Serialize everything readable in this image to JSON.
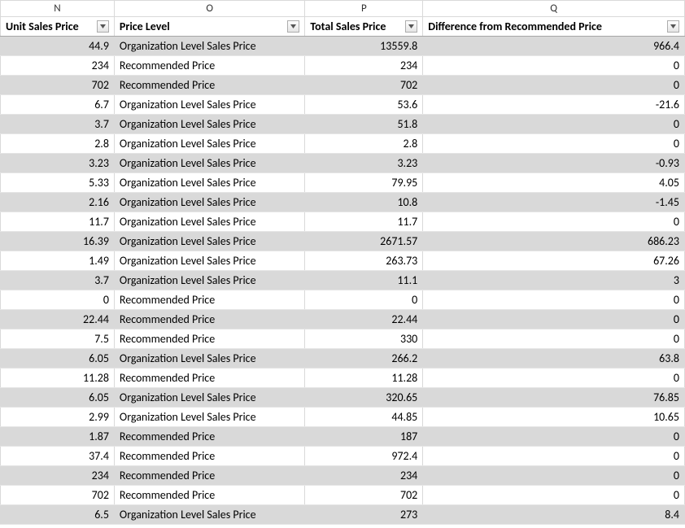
{
  "columns": {
    "letters": [
      "N",
      "O",
      "P",
      "Q"
    ],
    "labels": [
      "Unit Sales Price",
      "Price Level",
      "Total Sales Price",
      "Difference from Recommended Price"
    ]
  },
  "rows": [
    {
      "unit": "44.9",
      "level": "Organization Level Sales Price",
      "total": "13559.8",
      "diff": "966.4"
    },
    {
      "unit": "234",
      "level": "Recommended Price",
      "total": "234",
      "diff": "0"
    },
    {
      "unit": "702",
      "level": "Recommended Price",
      "total": "702",
      "diff": "0"
    },
    {
      "unit": "6.7",
      "level": "Organization Level Sales Price",
      "total": "53.6",
      "diff": "-21.6"
    },
    {
      "unit": "3.7",
      "level": "Organization Level Sales Price",
      "total": "51.8",
      "diff": "0"
    },
    {
      "unit": "2.8",
      "level": "Organization Level Sales Price",
      "total": "2.8",
      "diff": "0"
    },
    {
      "unit": "3.23",
      "level": "Organization Level Sales Price",
      "total": "3.23",
      "diff": "-0.93"
    },
    {
      "unit": "5.33",
      "level": "Organization Level Sales Price",
      "total": "79.95",
      "diff": "4.05"
    },
    {
      "unit": "2.16",
      "level": "Organization Level Sales Price",
      "total": "10.8",
      "diff": "-1.45"
    },
    {
      "unit": "11.7",
      "level": "Organization Level Sales Price",
      "total": "11.7",
      "diff": "0"
    },
    {
      "unit": "16.39",
      "level": "Organization Level Sales Price",
      "total": "2671.57",
      "diff": "686.23"
    },
    {
      "unit": "1.49",
      "level": "Organization Level Sales Price",
      "total": "263.73",
      "diff": "67.26"
    },
    {
      "unit": "3.7",
      "level": "Organization Level Sales Price",
      "total": "11.1",
      "diff": "3"
    },
    {
      "unit": "0",
      "level": "Recommended Price",
      "total": "0",
      "diff": "0"
    },
    {
      "unit": "22.44",
      "level": "Recommended Price",
      "total": "22.44",
      "diff": "0"
    },
    {
      "unit": "7.5",
      "level": "Recommended Price",
      "total": "330",
      "diff": "0"
    },
    {
      "unit": "6.05",
      "level": "Organization Level Sales Price",
      "total": "266.2",
      "diff": "63.8"
    },
    {
      "unit": "11.28",
      "level": "Recommended Price",
      "total": "11.28",
      "diff": "0"
    },
    {
      "unit": "6.05",
      "level": "Organization Level Sales Price",
      "total": "320.65",
      "diff": "76.85"
    },
    {
      "unit": "2.99",
      "level": "Organization Level Sales Price",
      "total": "44.85",
      "diff": "10.65"
    },
    {
      "unit": "1.87",
      "level": "Recommended Price",
      "total": "187",
      "diff": "0"
    },
    {
      "unit": "37.4",
      "level": "Recommended Price",
      "total": "972.4",
      "diff": "0"
    },
    {
      "unit": "234",
      "level": "Recommended Price",
      "total": "234",
      "diff": "0"
    },
    {
      "unit": "702",
      "level": "Recommended Price",
      "total": "702",
      "diff": "0"
    },
    {
      "unit": "6.5",
      "level": "Organization Level Sales Price",
      "total": "273",
      "diff": "8.4"
    }
  ]
}
